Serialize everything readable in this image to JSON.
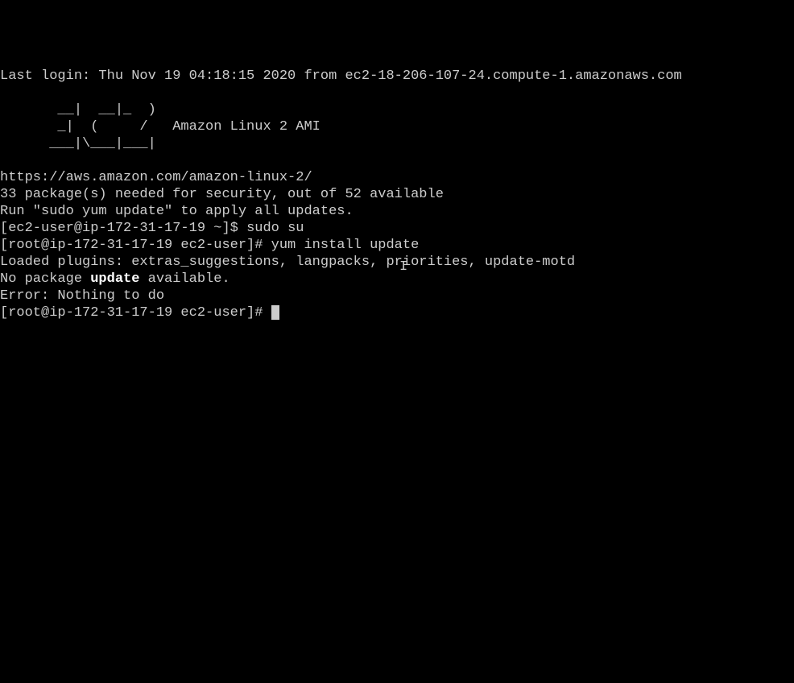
{
  "terminal": {
    "lastLogin": "Last login: Thu Nov 19 04:18:15 2020 from ec2-18-206-107-24.compute-1.amazonaws.com",
    "asciiArt1": "       __|  __|_  )",
    "asciiArt2": "       _|  (     /   Amazon Linux 2 AMI",
    "asciiArt3": "      ___|\\___|___|",
    "url": "https://aws.amazon.com/amazon-linux-2/",
    "securityUpdates": "33 package(s) needed for security, out of 52 available",
    "runUpdate": "Run \"sudo yum update\" to apply all updates.",
    "prompt1User": "[ec2-user@ip-172-31-17-19 ~]$ ",
    "cmd1": "sudo su",
    "prompt2Root": "[root@ip-172-31-17-19 ec2-user]# ",
    "cmd2": "yum install update",
    "loadedPlugins": "Loaded plugins: extras_suggestions, langpacks, priorities, update-motd",
    "noPackagePrefix": "No package ",
    "noPackageBold": "update",
    "noPackageSuffix": " available.",
    "error": "Error: Nothing to do",
    "prompt3Root": "[root@ip-172-31-17-19 ec2-user]# "
  }
}
